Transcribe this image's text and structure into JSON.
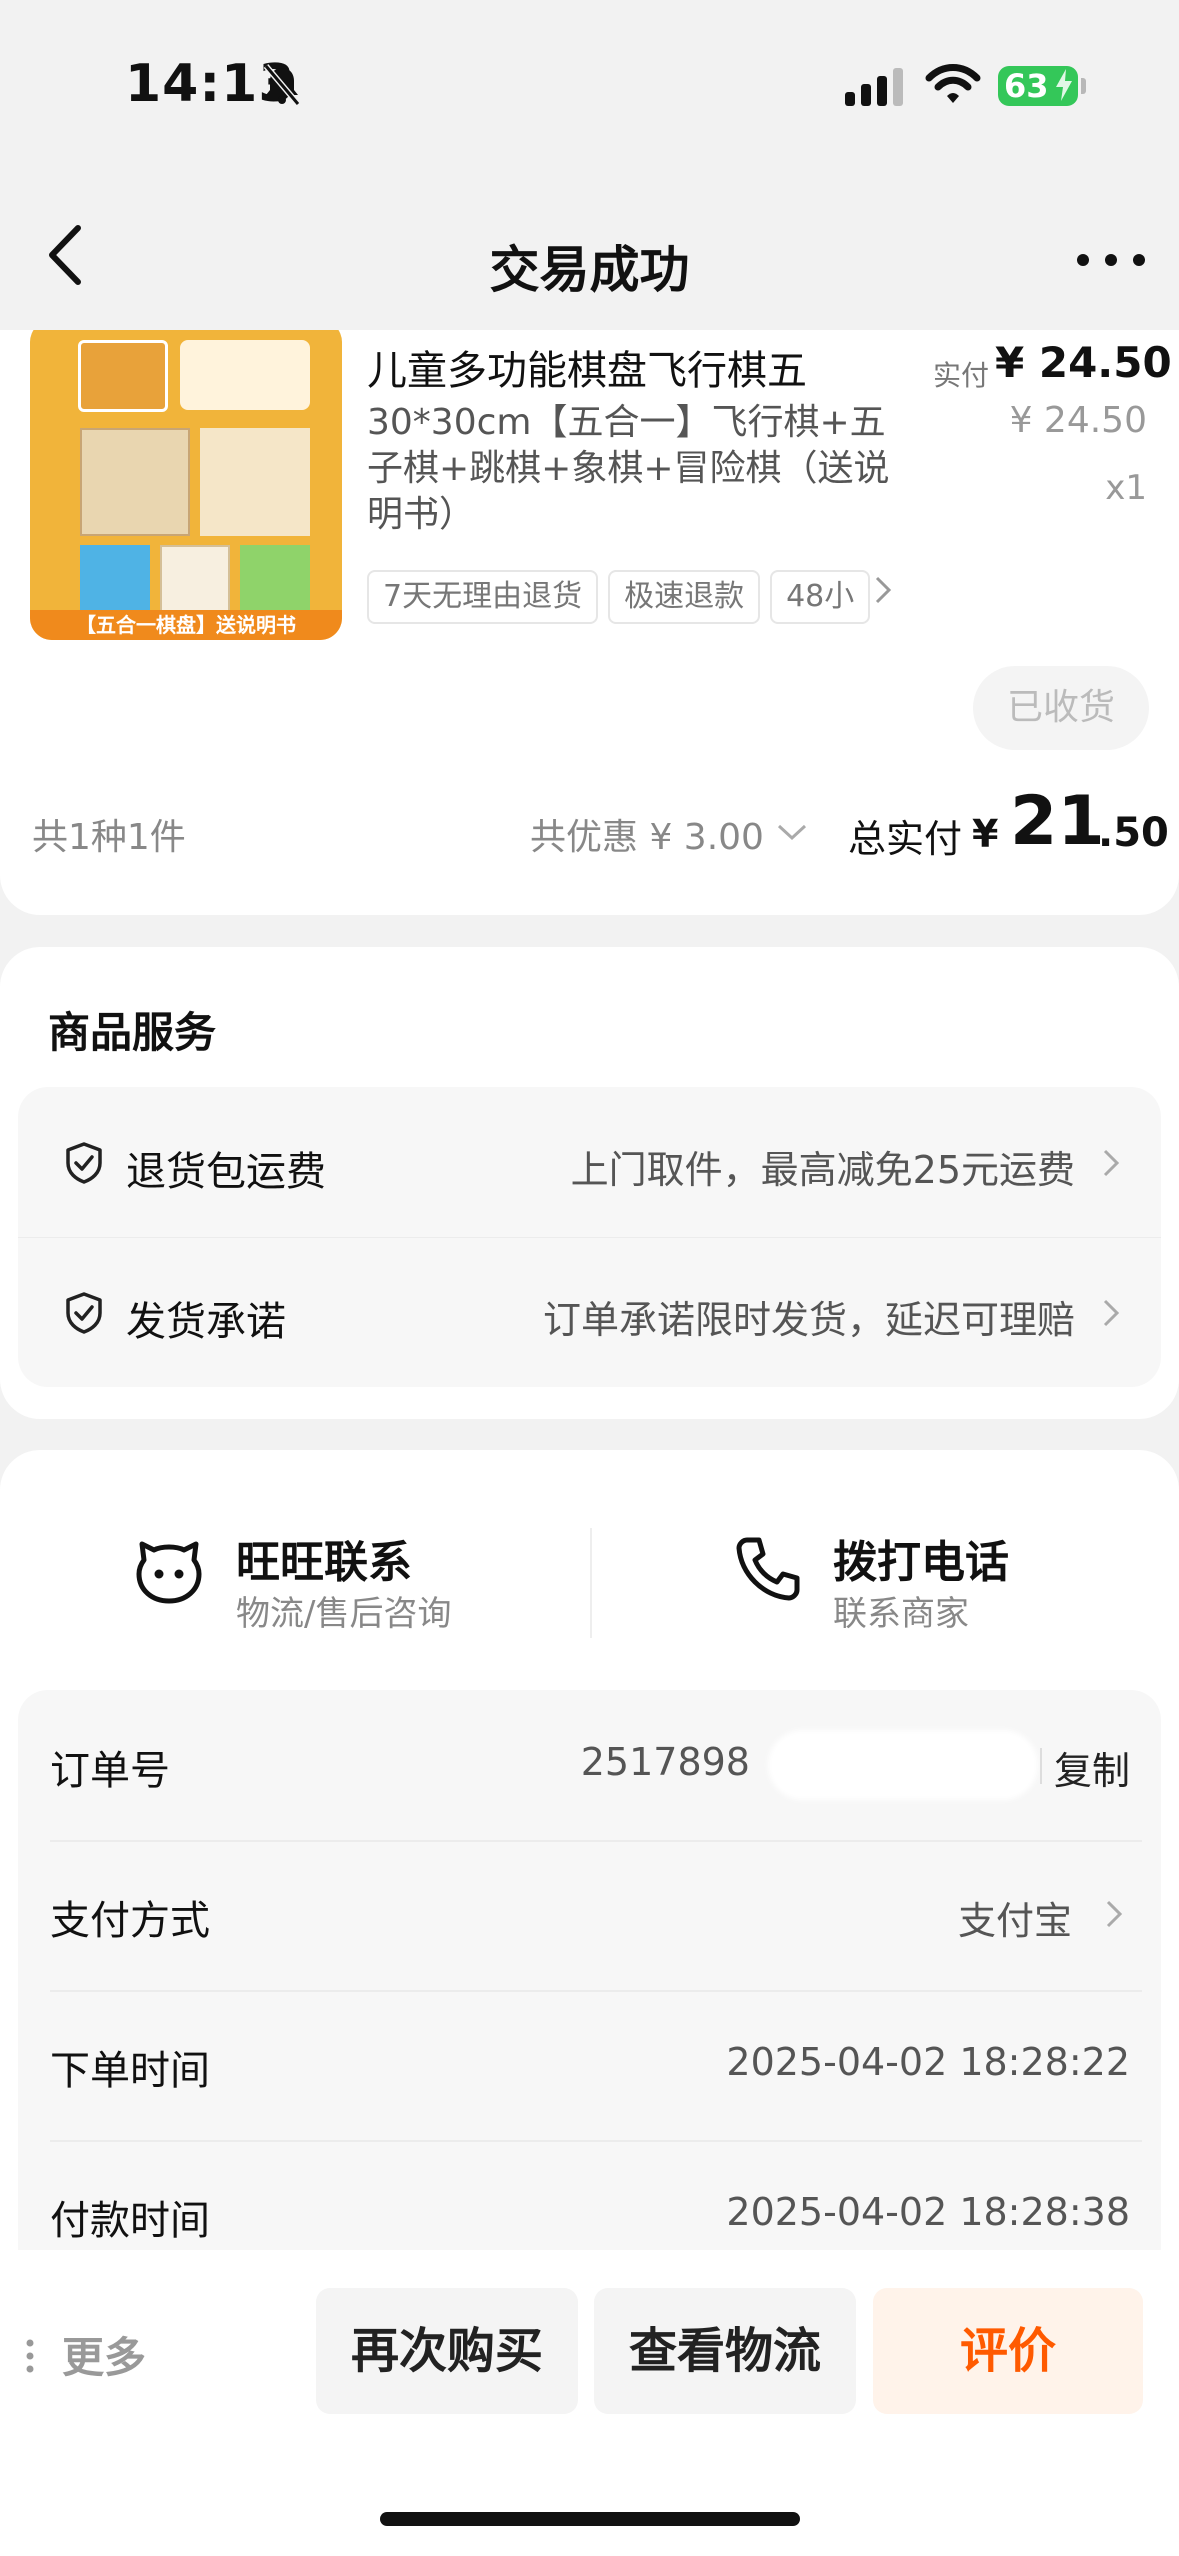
{
  "status": {
    "time": "14:13",
    "battery": "63"
  },
  "nav": {
    "title": "交易成功"
  },
  "product": {
    "title": "儿童多功能棋盘飞行棋五",
    "spec": "30*30cm【五合一】飞行棋+五子棋+跳棋+象棋+冒险棋（送说明书）",
    "thumb_banner": "【五合一棋盘】送说明书",
    "tags": [
      "7天无理由退货",
      "极速退款",
      "48小"
    ],
    "price_label": "实付",
    "price": "¥ 24.50",
    "price_original": "¥ 24.50",
    "quantity": "x1",
    "status_button": "已收货"
  },
  "summary": {
    "count": "共1种1件",
    "discount": "共优惠 ¥ 3.00",
    "total_label": "总实付",
    "total_yen": "¥",
    "total_int": "21",
    "total_dec": ".50"
  },
  "services": {
    "title": "商品服务",
    "items": [
      {
        "name": "退货包运费",
        "desc": "上门取件，最高减免25元运费"
      },
      {
        "name": "发货承诺",
        "desc": "订单承诺限时发货，延迟可理赔"
      }
    ]
  },
  "contact": {
    "wangwang": {
      "title": "旺旺联系",
      "sub": "物流/售后咨询"
    },
    "phone": {
      "title": "拨打电话",
      "sub": "联系商家"
    }
  },
  "info": {
    "order_label": "订单号",
    "order_value": "2517898",
    "copy_label": "复制",
    "pay_label": "支付方式",
    "pay_value": "支付宝",
    "order_time_label": "下单时间",
    "order_time_value": "2025-04-02 18:28:22",
    "pay_time_label": "付款时间",
    "pay_time_value": "2025-04-02 18:28:38"
  },
  "bottom": {
    "more": "更多",
    "rebuy": "再次购买",
    "logistics": "查看物流",
    "review": "评价"
  }
}
